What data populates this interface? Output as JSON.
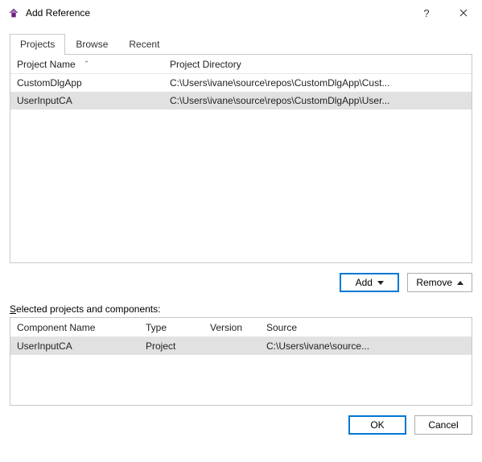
{
  "title": "Add Reference",
  "tabs": {
    "projects": "Projects",
    "browse": "Browse",
    "recent": "Recent"
  },
  "top_grid": {
    "headers": {
      "name": "Project Name",
      "dir": "Project Directory"
    },
    "rows": [
      {
        "name": "CustomDlgApp",
        "dir": "C:\\Users\\ivane\\source\\repos\\CustomDlgApp\\Cust..."
      },
      {
        "name": "UserInputCA",
        "dir": "C:\\Users\\ivane\\source\\repos\\CustomDlgApp\\User..."
      }
    ],
    "selected_index": 1
  },
  "buttons": {
    "add": "Add",
    "remove": "Remove",
    "ok": "OK",
    "cancel": "Cancel"
  },
  "selected_label": "Selected projects and components:",
  "bottom_grid": {
    "headers": {
      "name": "Component Name",
      "type": "Type",
      "version": "Version",
      "source": "Source"
    },
    "rows": [
      {
        "name": "UserInputCA",
        "type": "Project",
        "version": "",
        "source": "C:\\Users\\ivane\\source..."
      }
    ]
  }
}
